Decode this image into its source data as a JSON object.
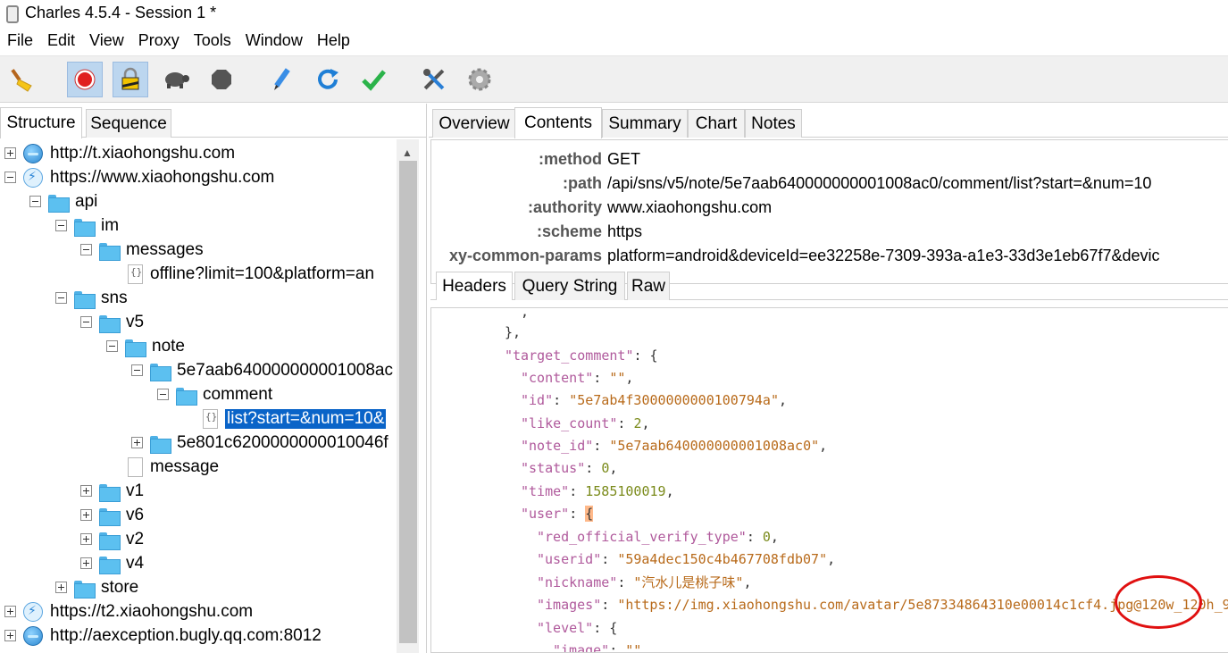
{
  "window": {
    "title": "Charles 4.5.4 - Session 1 *"
  },
  "menu": [
    "File",
    "Edit",
    "View",
    "Proxy",
    "Tools",
    "Window",
    "Help"
  ],
  "toolbar": {
    "buttons": [
      "broom-icon",
      "record-icon",
      "ssl-lock-icon",
      "turtle-icon",
      "stop-icon",
      "pen-icon",
      "refresh-icon",
      "check-icon",
      "tools-icon",
      "gear-icon"
    ]
  },
  "left_tabs": [
    "Structure",
    "Sequence"
  ],
  "tree": [
    {
      "label": "http://t.xiaohongshu.com"
    },
    {
      "label": "https://www.xiaohongshu.com"
    },
    {
      "label": "api"
    },
    {
      "label": "im"
    },
    {
      "label": "messages"
    },
    {
      "label": "offline?limit=100&platform=an"
    },
    {
      "label": "sns"
    },
    {
      "label": "v5"
    },
    {
      "label": "note"
    },
    {
      "label": "5e7aab640000000001008ac"
    },
    {
      "label": "comment"
    },
    {
      "label": "list?start=&num=10&"
    },
    {
      "label": "5e801c6200000000010046f"
    },
    {
      "label": "message"
    },
    {
      "label": "v1"
    },
    {
      "label": "v6"
    },
    {
      "label": "v2"
    },
    {
      "label": "v4"
    },
    {
      "label": "store"
    },
    {
      "label": "https://t2.xiaohongshu.com"
    },
    {
      "label": "http://aexception.bugly.qq.com:8012"
    }
  ],
  "right_tabs": [
    "Overview",
    "Contents",
    "Summary",
    "Chart",
    "Notes"
  ],
  "headers": [
    {
      "key": ":method",
      "value": "GET"
    },
    {
      "key": ":path",
      "value": "/api/sns/v5/note/5e7aab640000000001008ac0/comment/list?start=&num=10"
    },
    {
      "key": ":authority",
      "value": "www.xiaohongshu.com"
    },
    {
      "key": ":scheme",
      "value": "https"
    },
    {
      "key": "xy-common-params",
      "value": "platform=android&deviceId=ee32258e-7309-393a-a1e3-33d3e1eb67f7&devic"
    }
  ],
  "sub_tabs": [
    "Headers",
    "Query String",
    "Raw"
  ],
  "json_view": {
    "l0": ",",
    "l1": "},",
    "target_comment_key": "\"target_comment\"",
    "content_key": "\"content\"",
    "content_val": "\"\"",
    "id_key": "\"id\"",
    "id_val": "\"5e7ab4f3000000000100794a\"",
    "like_count_key": "\"like_count\"",
    "like_count_val": "2",
    "note_id_key": "\"note_id\"",
    "note_id_val": "\"5e7aab640000000001008ac0\"",
    "status_key": "\"status\"",
    "status_val": "0",
    "time_key": "\"time\"",
    "time_val": "1585100019",
    "user_key": "\"user\"",
    "red_official_key": "\"red_official_verify_type\"",
    "red_official_val": "0",
    "userid_key": "\"userid\"",
    "userid_val": "\"59a4dec150c4b467708fdb07\"",
    "nickname_key": "\"nickname\"",
    "nickname_val": "\"汽水儿是桃子味\"",
    "images_key": "\"images\"",
    "images_val": "\"https://img.xiaohongshu.com/avatar/5e87334864310e00014c1cf4.jpg@120w_120h_9",
    "level_key": "\"level\"",
    "image_key": "\"image\"",
    "image_val": "\"\""
  }
}
